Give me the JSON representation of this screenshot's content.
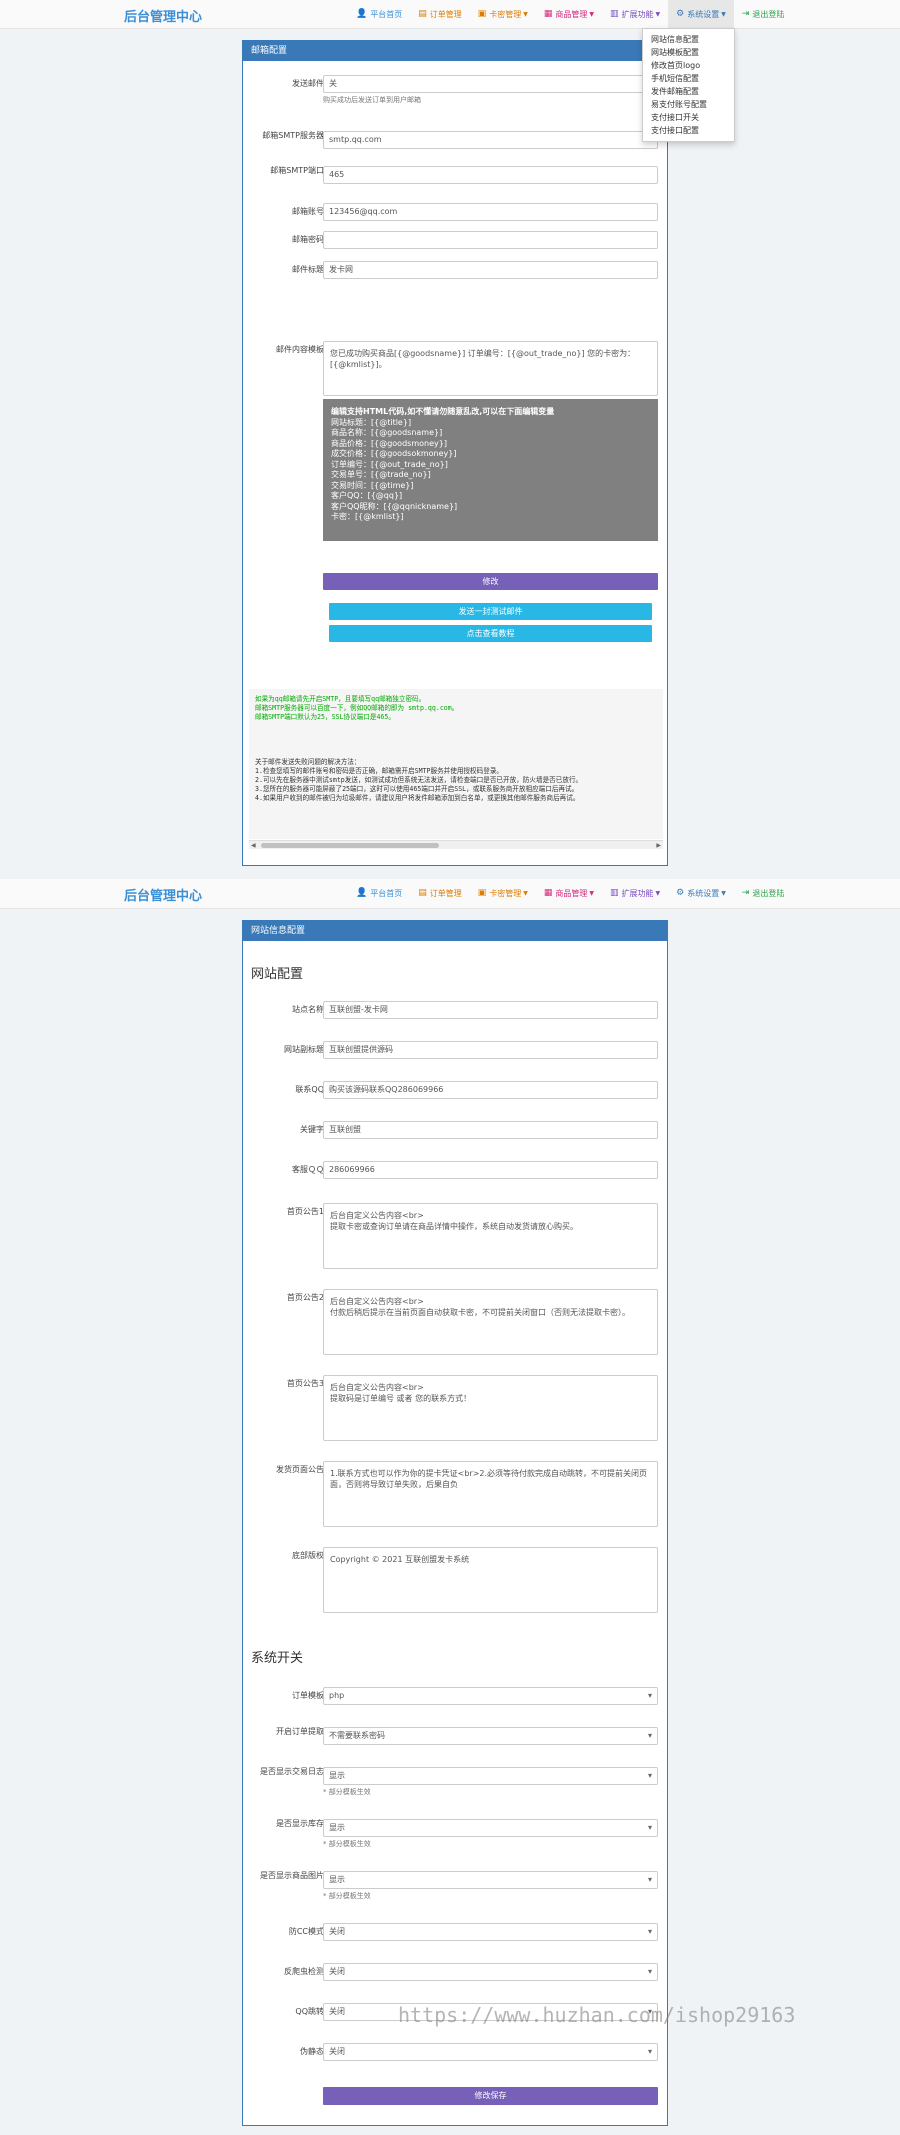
{
  "nav": {
    "brand": "后台管理中心",
    "items": [
      {
        "label": "平台首页",
        "icon": "user-icon",
        "color": "#3a90d8",
        "caret": false
      },
      {
        "label": "订单管理",
        "icon": "list-icon",
        "color": "#e07b00",
        "caret": false
      },
      {
        "label": "卡密管理",
        "icon": "card-icon",
        "color": "#e07b00",
        "caret": true
      },
      {
        "label": "商品管理",
        "icon": "cart-icon",
        "color": "#d4287a",
        "caret": true
      },
      {
        "label": "扩展功能",
        "icon": "apps-icon",
        "color": "#7a4bc2",
        "caret": true
      },
      {
        "label": "系统设置",
        "icon": "gear-icon",
        "color": "#3a79b7",
        "caret": true
      },
      {
        "label": "退出登陆",
        "icon": "logout-icon",
        "color": "#2aa44a",
        "caret": false
      }
    ],
    "dropdown": [
      "网站信息配置",
      "网站模板配置",
      "修改首页logo",
      "手机短信配置",
      "发件邮箱配置",
      "易支付账号配置",
      "支付接口开关",
      "支付接口配置"
    ]
  },
  "mail": {
    "title": "邮箱配置",
    "fields": [
      {
        "label": "发送邮件",
        "value": "关",
        "select": true,
        "hint": "购买成功后发送订单到用户邮箱"
      },
      {
        "label": "邮箱SMTP服务器",
        "value": "smtp.qq.com"
      },
      {
        "label": "邮箱SMTP端口",
        "value": "465"
      },
      {
        "label": "邮箱账号",
        "value": "123456@qq.com"
      },
      {
        "label": "邮箱密码",
        "value": ""
      },
      {
        "label": "邮件标题",
        "value": "发卡网"
      }
    ],
    "content_label": "邮件内容模板",
    "content_value": "您已成功购买商品[{@goodsname}] 订单编号：[{@out_trade_no}] 您的卡密为：[{@kmlist}]。",
    "vars_title": "编辑支持HTML代码,如不懂请勿随意乱改,可以在下面编辑变量",
    "vars": [
      "网站标题：[{@title}]",
      "商品名称：[{@goodsname}]",
      "商品价格：[{@goodsmoney}]",
      "成交价格：[{@goodsokmoney}]",
      "订单编号：[{@out_trade_no}]",
      "交易单号：[{@trade_no}]",
      "交易时间：[{@time}]",
      "客户QQ：[{@qq}]",
      "客户QQ昵称：[{@qqnickname}]",
      "卡密：[{@kmlist}]"
    ],
    "submit": "修改",
    "test_btn": "发送一封测试邮件",
    "tutorial_btn": "点击查看教程",
    "notes_green": [
      "如果为qq邮箱请先开启SMTP，且要填写qq邮箱独立密码。",
      "邮箱SMTP服务器可以百度一下，例如QQ邮箱的即为 smtp.qq.com。",
      "邮箱SMTP端口默认为25，SSL协议端口是465。"
    ],
    "notes_title": "关于邮件发送失败问题的解决方法：",
    "notes": [
      "1.检查您填写的邮件账号和密码是否正确，邮箱需开启SMTP服务并使用授权码登录。",
      "2.可以先在服务器中测试smtp发送，如测试成功但系统无法发送，请检查端口是否已开放，防火墙是否已放行。",
      "3.您所在的服务器可能屏蔽了25端口，这时可以使用465端口并开启SSL，或联系服务商开放相应端口后再试。",
      "4.如果用户收到的邮件被归为垃圾邮件，请建议用户将发件邮箱添加到白名单，或更换其他邮件服务商后再试。"
    ]
  },
  "site": {
    "title": "网站信息配置",
    "section1": "网站配置",
    "fields": [
      {
        "label": "站点名称",
        "value": "互联创盟-发卡网"
      },
      {
        "label": "网站副标题",
        "value": "互联创盟提供源码"
      },
      {
        "label": "联系QQ",
        "value": "购买该源码联系QQ286069966"
      },
      {
        "label": "关键字",
        "value": "互联创盟"
      },
      {
        "label": "客服ＱＱ",
        "value": "286069966"
      }
    ],
    "textareas": [
      {
        "label": "首页公告1",
        "value": "后台自定义公告内容<br>\n提取卡密或查询订单请在商品详情中操作，系统自动发货请放心购买。"
      },
      {
        "label": "首页公告2",
        "value": "后台自定义公告内容<br>\n付款后稍后提示在当前页面自动获取卡密，不可提前关闭窗口（否则无法提取卡密）。"
      },
      {
        "label": "首页公告3",
        "value": "后台自定义公告内容<br>\n提取码是订单编号 或者 您的联系方式！"
      },
      {
        "label": "发货页面公告",
        "value": "1.联系方式也可以作为你的提卡凭证<br>2.必须等待付款完成自动跳转，不可提前关闭页面，否则将导致订单失败，后果自负"
      },
      {
        "label": "底部版权",
        "value": "Copyright © 2021 互联创盟发卡系统"
      }
    ],
    "section2": "系统开关",
    "switches": [
      {
        "label": "订单模板",
        "value": "php",
        "hint": ""
      },
      {
        "label": "开启订单提取",
        "value": "不需要联系密码",
        "hint": ""
      },
      {
        "label": "是否显示交易日志",
        "value": "显示",
        "hint": "* 部分模板生效"
      },
      {
        "label": "是否显示库存",
        "value": "显示",
        "hint": "* 部分模板生效"
      },
      {
        "label": "是否显示商品图片",
        "value": "显示",
        "hint": "* 部分模板生效"
      },
      {
        "label": "防CC模式",
        "value": "关闭",
        "hint": ""
      },
      {
        "label": "反爬虫检测",
        "value": "关闭",
        "hint": ""
      },
      {
        "label": "QQ跳转",
        "value": "关闭",
        "hint": ""
      },
      {
        "label": "伪静态",
        "value": "关闭",
        "hint": ""
      }
    ],
    "submit": "修改保存"
  },
  "watermark": "https://www.huzhan.com/ishop29163"
}
